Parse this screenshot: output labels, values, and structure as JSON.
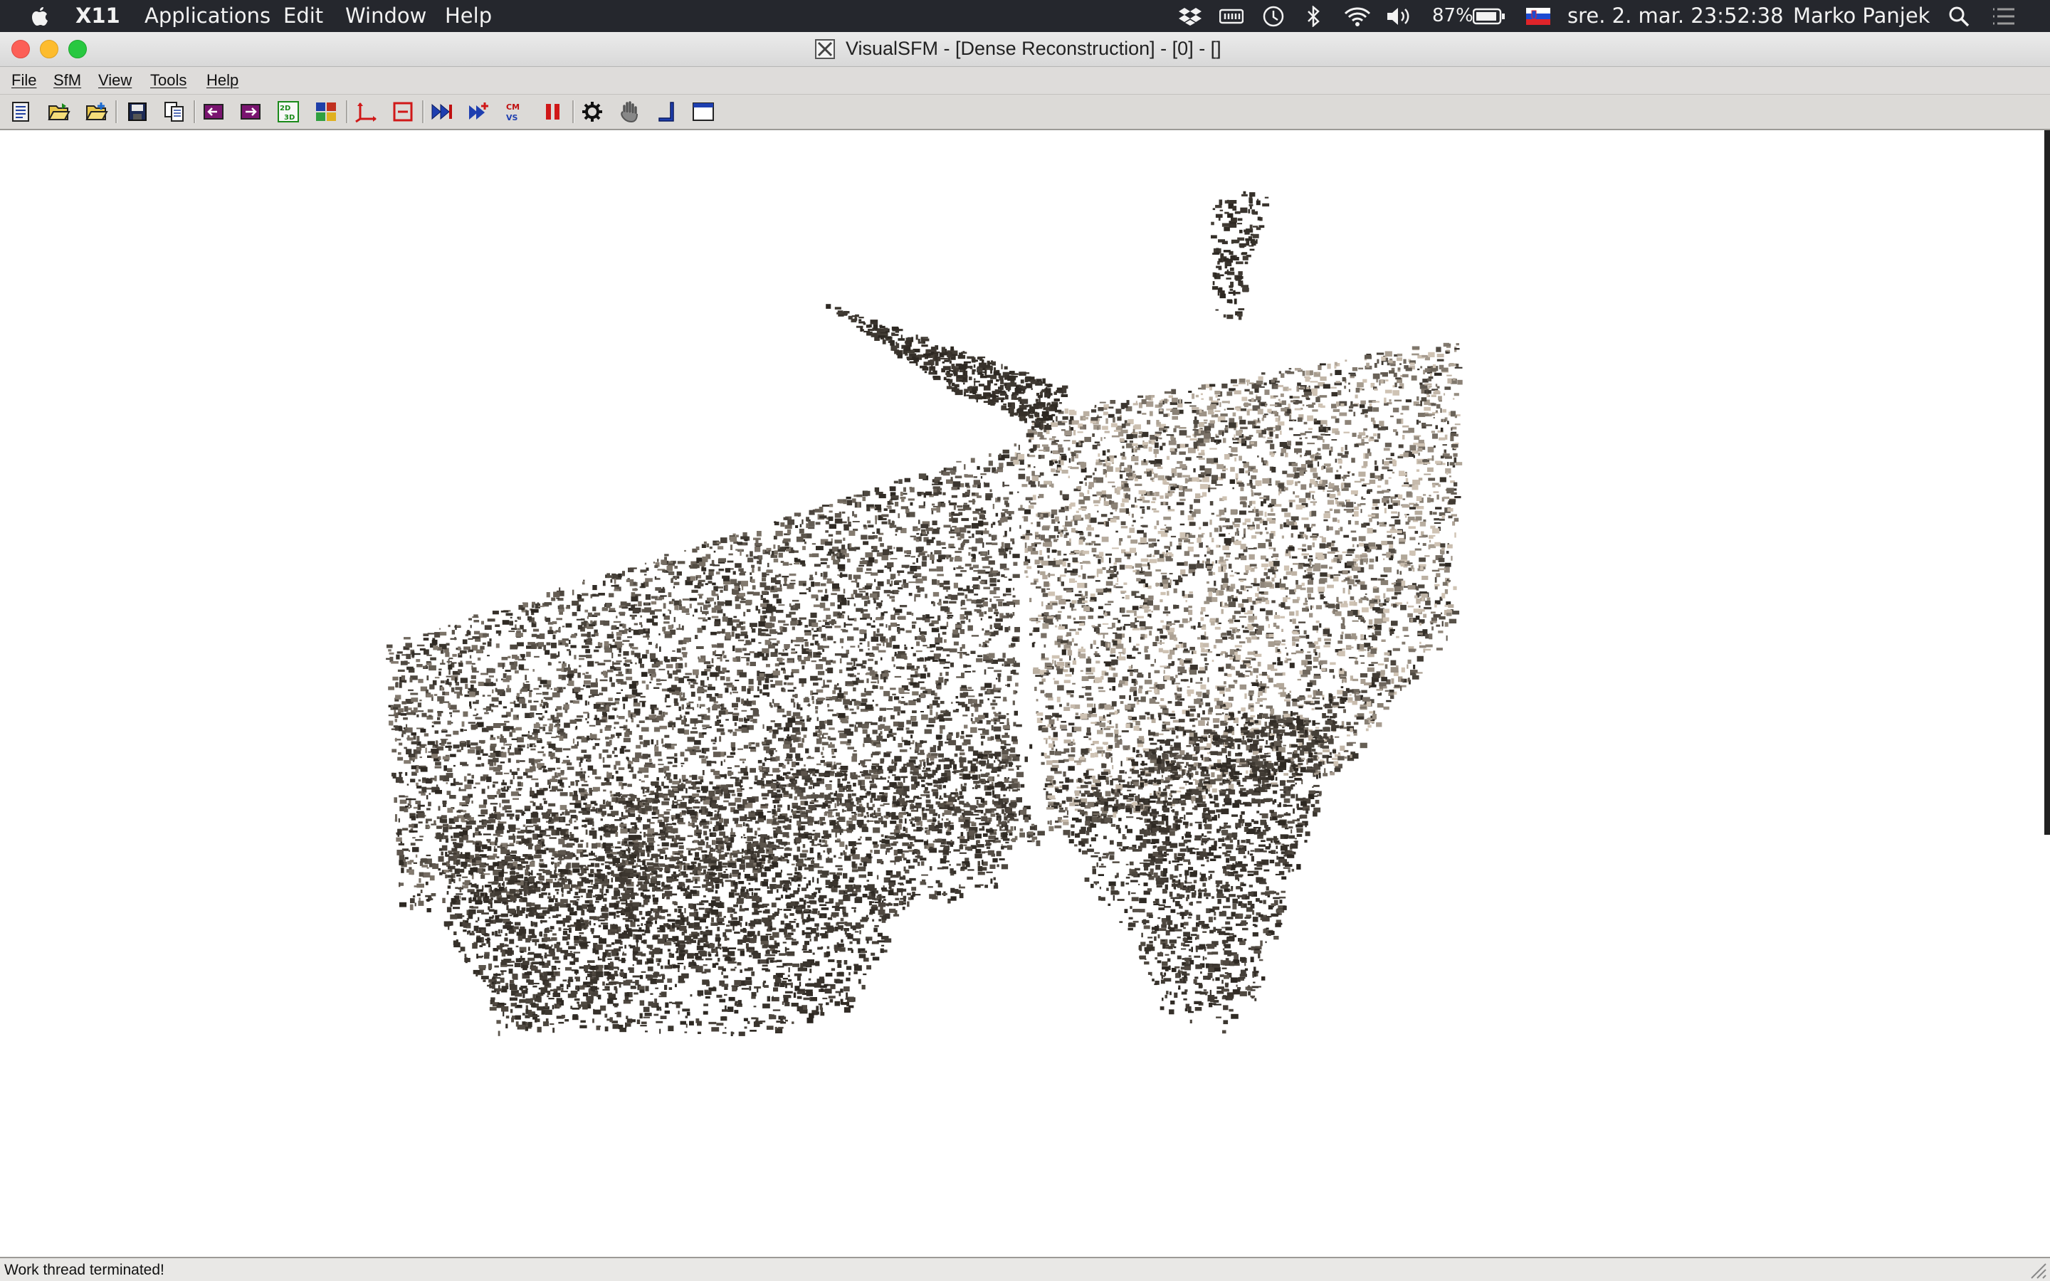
{
  "macbar": {
    "app_name": "X11",
    "menus": [
      "Applications",
      "Edit",
      "Window",
      "Help"
    ],
    "battery": "87%",
    "datetime": "sre. 2. mar.  23:52:38",
    "user": "Marko Panjek",
    "icons": [
      "apple-icon",
      "dropbox-icon",
      "memory-icon",
      "time-machine-icon",
      "bluetooth-icon",
      "wifi-icon",
      "volume-icon",
      "battery-icon",
      "slovenia-flag-icon",
      "spotlight-icon",
      "notification-center-icon"
    ]
  },
  "window": {
    "title": "VisualSFM - [Dense Reconstruction] - [0] - []"
  },
  "app_menu": [
    "File",
    "SfM",
    "View",
    "Tools",
    "Help"
  ],
  "toolbar": {
    "buttons": [
      "new-window-icon",
      "open-icon",
      "open-add-icon",
      "save-icon",
      "copy-icon",
      "prev-icon",
      "next-icon",
      "toggle-2d3d-icon",
      "thumbnails-icon",
      "axis-icon",
      "crop-icon",
      "compute-missing-match-icon",
      "sparse-reconstruction-icon",
      "dense-reconstruction-icon",
      "pause-icon",
      "settings-icon",
      "hand-icon",
      "ruler-icon",
      "window-icon"
    ]
  },
  "colors": {
    "macbar_bg": "#25272d",
    "close": "#fc5f57",
    "minimize": "#fdbc2e",
    "zoom": "#28c840",
    "point_dark": "#2b2620",
    "point_light": "#cfc3b4"
  },
  "status": {
    "text": "Work thread terminated!"
  }
}
